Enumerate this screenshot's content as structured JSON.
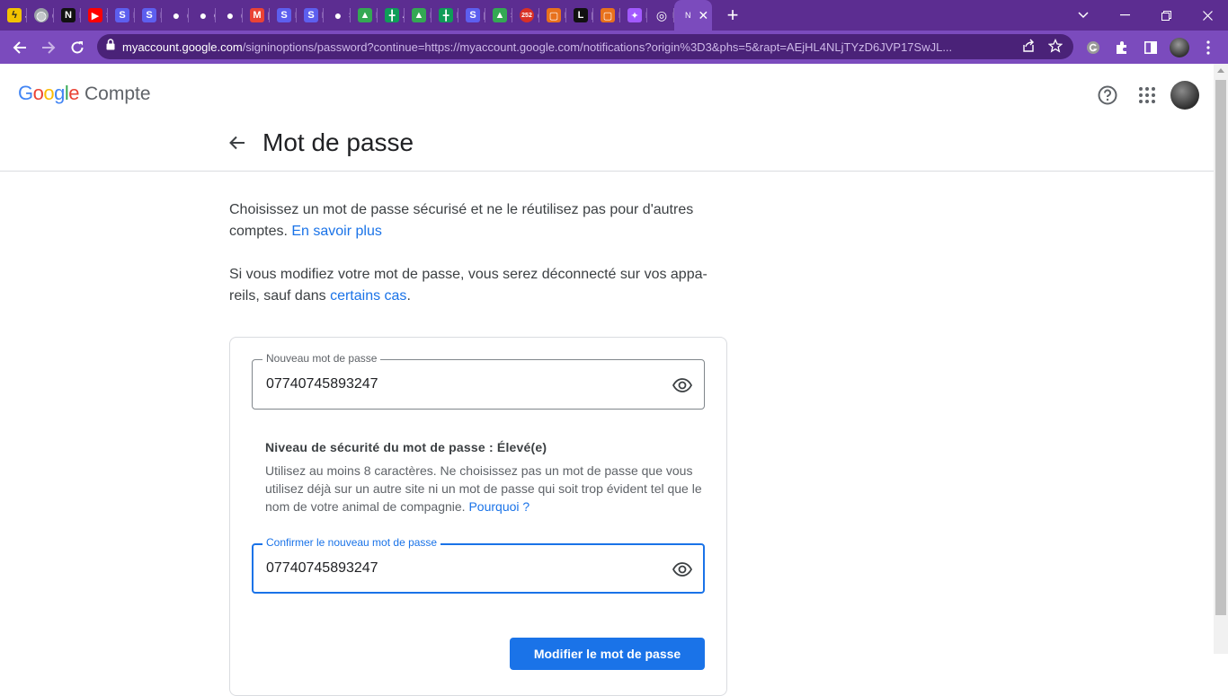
{
  "browser": {
    "tabs": [
      {
        "icon": "bolt-icon",
        "letter": "J",
        "color": "#f2c200"
      },
      {
        "icon": "globe-icon",
        "letter": "(",
        "color": "#9aa0a6"
      },
      {
        "icon": "notion-icon",
        "letter": "I",
        "color": "#111111"
      },
      {
        "icon": "youtube-icon",
        "letter": "S",
        "color": "#ff0000"
      },
      {
        "icon": "s-app-icon",
        "letter": "I",
        "color": "#5d5fef"
      },
      {
        "icon": "s-app-icon",
        "letter": "I",
        "color": "#5d5fef"
      },
      {
        "icon": "github-icon",
        "letter": "(",
        "color": "#ffffff"
      },
      {
        "icon": "github-icon",
        "letter": "g",
        "color": "#ffffff"
      },
      {
        "icon": "github-icon",
        "letter": "(",
        "color": "#ffffff"
      },
      {
        "icon": "gmail-icon",
        "letter": "[",
        "color": "#ea4335"
      },
      {
        "icon": "s-app-icon",
        "letter": "I",
        "color": "#5d5fef"
      },
      {
        "icon": "s-app-icon",
        "letter": "F",
        "color": "#5d5fef"
      },
      {
        "icon": "github-icon",
        "letter": "S",
        "color": "#ffffff"
      },
      {
        "icon": "drive-icon",
        "letter": "I",
        "color": "#34a853"
      },
      {
        "icon": "sheets-icon",
        "letter": "A",
        "color": "#0f9d58"
      },
      {
        "icon": "drive-icon",
        "letter": "I",
        "color": "#34a853"
      },
      {
        "icon": "sheets-icon",
        "letter": "F",
        "color": "#0f9d58"
      },
      {
        "icon": "s-app-icon",
        "letter": "[",
        "color": "#5d5fef"
      },
      {
        "icon": "drive-icon",
        "letter": "S",
        "color": "#34a853"
      },
      {
        "icon": "calendar-icon",
        "letter": "(",
        "color": "#d93025"
      },
      {
        "icon": "box-icon",
        "letter": "E",
        "color": "#e8711c"
      },
      {
        "icon": "l-app-icon",
        "letter": "[",
        "color": "#111111"
      },
      {
        "icon": "box-icon",
        "letter": "I",
        "color": "#e8711c"
      },
      {
        "icon": "figma-icon",
        "letter": "I",
        "color": "#a259ff"
      },
      {
        "icon": "chrome-icon",
        "letter": "I",
        "color": "#ffffff"
      }
    ],
    "active_tab": {
      "icon": "google-account-icon",
      "letter": "N",
      "close": "✕"
    },
    "new_tab": "+",
    "calendar_badge": "252",
    "url_host": "myaccount.google.com",
    "url_rest": "/signinoptions/password?continue=https://myaccount.google.com/notifications?origin%3D3&phs=5&rapt=AEjHL4NLjTYzD6JVP17SwJL..."
  },
  "header": {
    "logo_letters": [
      {
        "ch": "G",
        "color": "#4285f4"
      },
      {
        "ch": "o",
        "color": "#ea4335"
      },
      {
        "ch": "o",
        "color": "#fbbc05"
      },
      {
        "ch": "g",
        "color": "#4285f4"
      },
      {
        "ch": "l",
        "color": "#34a853"
      },
      {
        "ch": "e",
        "color": "#ea4335"
      }
    ],
    "product": "Compte"
  },
  "page": {
    "title": "Mot de passe",
    "intro1_text": "Choisissez un mot de passe sécurisé et ne le réutilisez pas pour d'autres comptes. ",
    "intro1_link": "En savoir plus",
    "intro2_text": "Si vous modifiez votre mot de passe, vous serez déconnecté sur vos appa-reils, sauf dans ",
    "intro2_link": "certains cas",
    "intro2_end": "."
  },
  "form": {
    "new_password_label": "Nouveau mot de passe",
    "new_password_value": "07740745893247",
    "strength_title": "Niveau de sécurité du mot de passe : Élevé(e)",
    "strength_text": "Utilisez au moins 8 caractères. Ne choisissez pas un mot de passe que vous utilisez déjà sur un autre site ni un mot de passe qui soit trop évident tel que le nom de votre animal de compagnie. ",
    "strength_link": "Pourquoi ?",
    "confirm_label": "Confirmer le nouveau mot de passe",
    "confirm_value": "07740745893247",
    "submit_label": "Modifier le mot de passe"
  }
}
